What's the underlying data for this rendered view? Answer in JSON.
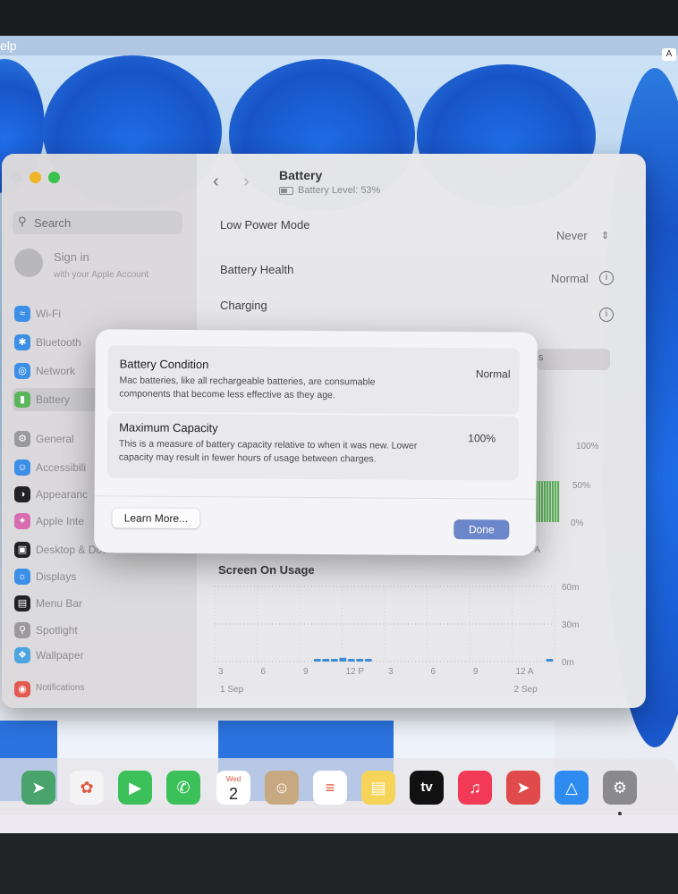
{
  "menubar": {
    "partial_menu": "elp",
    "input_badge": "A"
  },
  "window": {
    "title": "Battery",
    "subtitle": "Battery Level: 53%",
    "sidebar": {
      "search_placeholder": "Search",
      "sign_in": {
        "title": "Sign in",
        "subtitle": "with your Apple Account"
      },
      "items": [
        {
          "label": "Wi-Fi",
          "icon": "wifi-icon",
          "color": "#3a8ee6"
        },
        {
          "label": "Bluetooth",
          "icon": "bluetooth-icon",
          "color": "#3a8ee6"
        },
        {
          "label": "Network",
          "icon": "network-icon",
          "color": "#3a8ee6"
        },
        {
          "label": "Battery",
          "icon": "battery-icon",
          "color": "#5ab55a",
          "selected": true
        },
        {
          "label": "General",
          "icon": "gear-icon",
          "color": "#9a989c"
        },
        {
          "label": "Accessibili",
          "icon": "accessibility-icon",
          "color": "#3a8ee6"
        },
        {
          "label": "Appearanc",
          "icon": "appearance-icon",
          "color": "#1f1e21"
        },
        {
          "label": "Apple Inte",
          "icon": "apple-intelligence-icon",
          "color": "#d96ab0"
        },
        {
          "label": "Desktop & Dock",
          "icon": "dock-icon",
          "color": "#1f1e21"
        },
        {
          "label": "Displays",
          "icon": "displays-icon",
          "color": "#3a8ee6"
        },
        {
          "label": "Menu Bar",
          "icon": "menu-bar-icon",
          "color": "#1f1e21"
        },
        {
          "label": "Spotlight",
          "icon": "spotlight-icon",
          "color": "#9a989c"
        },
        {
          "label": "Wallpaper",
          "icon": "wallpaper-icon",
          "color": "#4aa3e0"
        },
        {
          "label": "Notifications",
          "icon": "notifications-icon",
          "color": "#e2574c"
        }
      ]
    },
    "rows": {
      "low_power_mode": {
        "label": "Low Power Mode",
        "value": "Never"
      },
      "battery_health": {
        "label": "Battery Health",
        "value": "Normal"
      },
      "charging": {
        "label": "Charging"
      },
      "partial_tab": "s"
    },
    "chart": {
      "level_axis": {
        "top": "100%",
        "mid": "50%",
        "bottom": "0%"
      },
      "partial_x": "12 A"
    }
  },
  "chart_data": {
    "type": "bar",
    "title": "Screen On Usage",
    "x_ticks": [
      "3",
      "6",
      "9",
      "12 P",
      "3",
      "6",
      "9",
      "12 A"
    ],
    "x_group_labels": [
      "1 Sep",
      "2 Sep"
    ],
    "y_ticks": [
      "60m",
      "30m",
      "0m"
    ],
    "ylim": [
      0,
      60
    ],
    "bars": [
      {
        "slot": 7.0,
        "value": 1
      },
      {
        "slot": 7.6,
        "value": 2
      },
      {
        "slot": 8.2,
        "value": 1
      },
      {
        "slot": 8.8,
        "value": 3
      },
      {
        "slot": 9.4,
        "value": 1
      },
      {
        "slot": 10.0,
        "value": 1
      },
      {
        "slot": 10.6,
        "value": 1
      },
      {
        "slot": 23.4,
        "value": 1
      }
    ]
  },
  "modal": {
    "battery_condition": {
      "title": "Battery Condition",
      "value": "Normal",
      "line1": "Mac batteries, like all rechargeable batteries, are consumable",
      "line2": "components that become less effective as they age."
    },
    "maximum_capacity": {
      "title": "Maximum Capacity",
      "value": "100%",
      "line1": "This is a measure of battery capacity relative to when it was new. Lower",
      "line2": "capacity may result in fewer hours of usage between charges."
    },
    "learn_more": "Learn More...",
    "done": "Done"
  },
  "dock": {
    "calendar": {
      "weekday": "Wed",
      "day": "2"
    },
    "tv_label": "tv",
    "items": [
      {
        "icon": "maps-icon",
        "color": "#4aa36a"
      },
      {
        "icon": "photos-icon",
        "color": "#f4f4f4"
      },
      {
        "icon": "facetime-icon",
        "color": "#3cc15a"
      },
      {
        "icon": "phone-icon",
        "color": "#3cc15a"
      },
      {
        "icon": "calendar-icon",
        "color": "#ffffff"
      },
      {
        "icon": "contacts-icon",
        "color": "#c8a880"
      },
      {
        "icon": "reminders-icon",
        "color": "#ffffff"
      },
      {
        "icon": "notes-icon",
        "color": "#f6d45a"
      },
      {
        "icon": "apple-tv-icon",
        "color": "#111111"
      },
      {
        "icon": "music-icon",
        "color": "#f23a56"
      },
      {
        "icon": "launchpad-icon",
        "color": "#e04a4a"
      },
      {
        "icon": "app-store-icon",
        "color": "#2e8bf0"
      },
      {
        "icon": "system-settings-icon",
        "color": "#8a898c"
      }
    ]
  }
}
